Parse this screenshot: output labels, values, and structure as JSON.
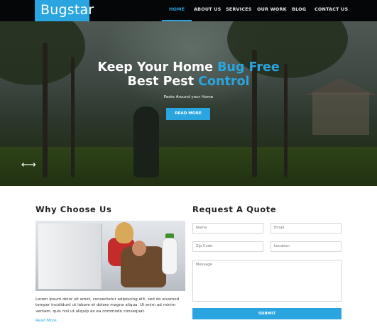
{
  "brand": {
    "logo": "Bugstar"
  },
  "nav": {
    "items": [
      {
        "label": "HOME",
        "active": true
      },
      {
        "label": "ABOUT US",
        "active": false
      },
      {
        "label": "SERVICES",
        "active": false
      },
      {
        "label": "OUR WORK",
        "active": false
      },
      {
        "label": "BLOG",
        "active": false
      },
      {
        "label": "CONTACT US",
        "active": false
      }
    ]
  },
  "hero": {
    "line1_white": "Keep Your Home ",
    "line1_blue": "Bug Free",
    "line2_white": "Best Pest ",
    "line2_blue": "Control",
    "subtitle": "Paste Around your Home",
    "button": "READ MORE",
    "slider_arrows": "←→"
  },
  "why": {
    "title": "Why Choose Us",
    "body": "Lorem ipsum dolor sit amet, consectetur adipiscing elit, sed do eiusmod tempor incididunt ut labore et dolore magna aliqua. Ut enim ad minim veniam, quis nisi ut aliquip ex ea commodo consequat.",
    "link": "Read More"
  },
  "quote": {
    "title": "Request A Quote",
    "placeholders": {
      "name": "Name",
      "email": "Email",
      "zip": "Zip Code",
      "location": "Location",
      "message": "Message"
    },
    "submit": "SUBMIT"
  },
  "colors": {
    "accent": "#2aa5e0",
    "nav_bg": "#050607"
  }
}
